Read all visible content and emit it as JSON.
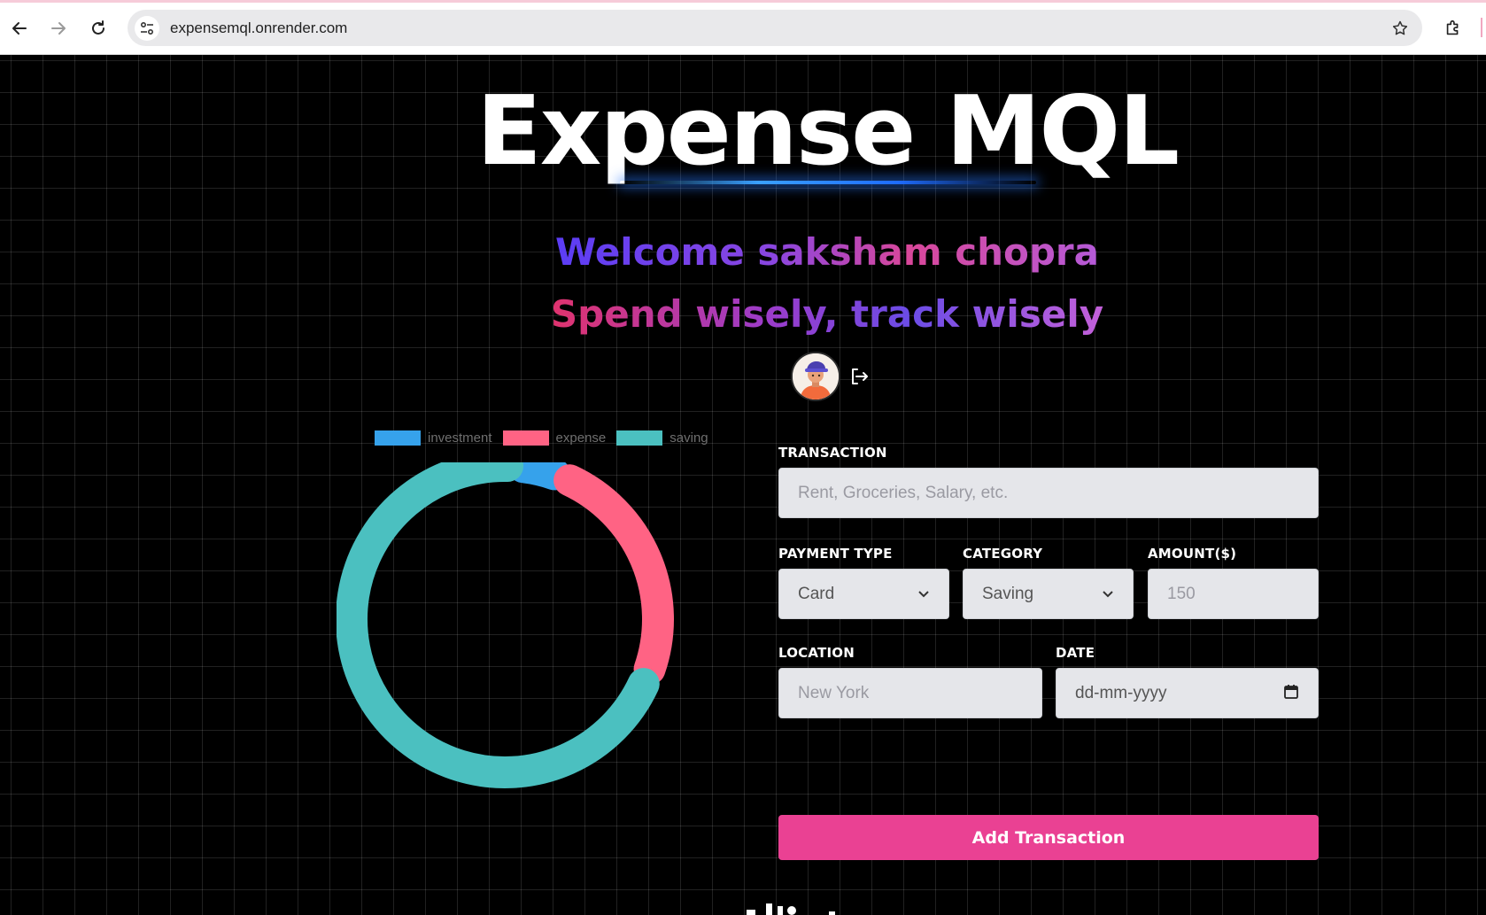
{
  "browser": {
    "url": "expensemql.onrender.com"
  },
  "header": {
    "title": "Expense MQL",
    "welcome": "Welcome saksham chopra",
    "tagline": "Spend wisely, track wisely"
  },
  "chart_data": {
    "type": "doughnut",
    "title": "",
    "legend_position": "top",
    "legend": [
      "investment",
      "expense",
      "saving"
    ],
    "colors": [
      "#36a2eb",
      "#ff6384",
      "#4bc0c0"
    ],
    "values": [
      5,
      25,
      70
    ]
  },
  "form": {
    "transaction_label": "TRANSACTION",
    "transaction_placeholder": "Rent, Groceries, Salary, etc.",
    "payment_type_label": "PAYMENT TYPE",
    "payment_type_value": "Card",
    "category_label": "CATEGORY",
    "category_value": "Saving",
    "amount_label": "AMOUNT($)",
    "amount_placeholder": "150",
    "location_label": "LOCATION",
    "location_placeholder": "New York",
    "date_label": "DATE",
    "date_placeholder": "dd-mm-yyyy",
    "submit_label": "Add Transaction"
  },
  "colors": {
    "accent": "#ea4193",
    "investment": "#36a2eb",
    "expense": "#ff6384",
    "saving": "#4bc0c0"
  }
}
